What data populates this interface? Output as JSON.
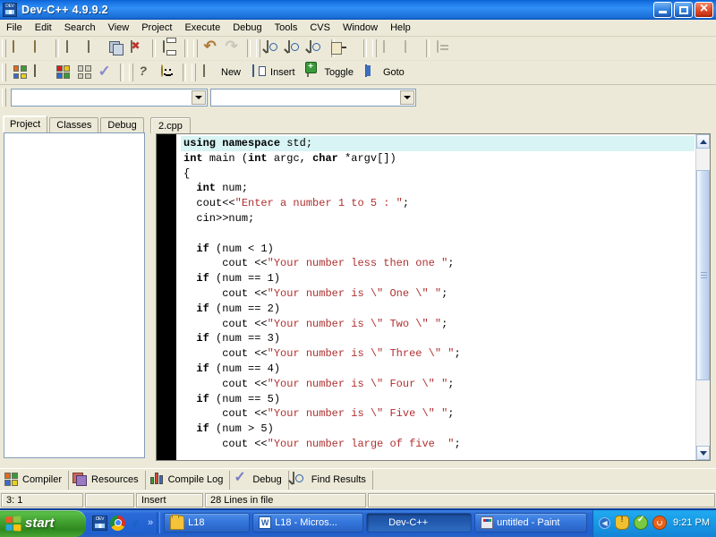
{
  "window": {
    "title": "Dev-C++ 4.9.9.2",
    "app_icon": "devcpp-icon",
    "controls": {
      "minimize": "minimize-button",
      "maximize": "maximize-button",
      "close": "close-button"
    },
    "titlebar_color": "#2f8ef5"
  },
  "menubar": {
    "items": [
      "File",
      "Edit",
      "Search",
      "View",
      "Project",
      "Execute",
      "Debug",
      "Tools",
      "CVS",
      "Window",
      "Help"
    ]
  },
  "toolbar_row1": [
    {
      "name": "new-project-icon",
      "icon": "shield"
    },
    {
      "name": "open-project-icon",
      "icon": "shield2"
    },
    {
      "name": "new-file-icon",
      "icon": "doc"
    },
    {
      "name": "open-file-icon",
      "icon": "doc2"
    },
    {
      "name": "save-file-icon",
      "icon": "saveall"
    },
    {
      "name": "close-file-icon",
      "icon": "closered"
    },
    {
      "name": "print-icon",
      "icon": "print"
    },
    {
      "name": "undo-icon",
      "icon": "undo"
    },
    {
      "name": "redo-icon",
      "icon": "redo"
    },
    {
      "name": "find-icon",
      "icon": "find"
    },
    {
      "name": "find-next-icon",
      "icon": "find"
    },
    {
      "name": "replace-icon",
      "icon": "find"
    },
    {
      "name": "goto-line-icon",
      "icon": "goline"
    },
    {
      "name": "previous-page-icon",
      "icon": "page"
    },
    {
      "name": "next-page-icon",
      "icon": "page"
    },
    {
      "name": "properties-icon",
      "icon": "prop"
    }
  ],
  "toolbar_row2": [
    {
      "name": "project-manager-icon",
      "icon": "grid4c"
    },
    {
      "name": "window-icon",
      "icon": "win"
    },
    {
      "name": "color-grid-icon",
      "icon": "grid4color"
    },
    {
      "name": "tile-icon",
      "icon": "grid4"
    },
    {
      "name": "compile-check-icon",
      "icon": "check"
    },
    {
      "name": "help-icon",
      "icon": "quest"
    },
    {
      "name": "about-icon",
      "icon": "smiley"
    }
  ],
  "toolbar_text_buttons": [
    {
      "name": "new-button",
      "label": "New",
      "icon": "newdoc"
    },
    {
      "name": "insert-button",
      "label": "Insert",
      "icon": "insert"
    },
    {
      "name": "toggle-button",
      "label": "Toggle",
      "icon": "toggle"
    },
    {
      "name": "goto-button",
      "label": "Goto",
      "icon": "goto"
    }
  ],
  "combos": {
    "left_value": "",
    "right_value": ""
  },
  "left_panel": {
    "tabs": [
      {
        "label": "Project",
        "active": true
      },
      {
        "label": "Classes",
        "active": false
      },
      {
        "label": "Debug",
        "active": false
      }
    ],
    "tree_items": []
  },
  "editor": {
    "file_tabs": [
      {
        "label": "2.cpp",
        "active": true
      }
    ],
    "highlighted_line": 1,
    "code_lines": [
      {
        "indent": 0,
        "highlight": true,
        "tokens": [
          {
            "t": "kw",
            "v": "using namespace "
          },
          {
            "t": "pl",
            "v": "std;"
          }
        ]
      },
      {
        "indent": 0,
        "highlight": false,
        "tokens": [
          {
            "t": "kw",
            "v": "int "
          },
          {
            "t": "pl",
            "v": "main ("
          },
          {
            "t": "kw",
            "v": "int "
          },
          {
            "t": "pl",
            "v": "argc, "
          },
          {
            "t": "kw",
            "v": "char "
          },
          {
            "t": "pl",
            "v": "*argv[])"
          }
        ]
      },
      {
        "indent": 0,
        "highlight": false,
        "tokens": [
          {
            "t": "pl",
            "v": "{"
          }
        ]
      },
      {
        "indent": 1,
        "highlight": false,
        "tokens": [
          {
            "t": "kw",
            "v": "int "
          },
          {
            "t": "pl",
            "v": "num;"
          }
        ]
      },
      {
        "indent": 1,
        "highlight": false,
        "tokens": [
          {
            "t": "pl",
            "v": "cout<<"
          },
          {
            "t": "st",
            "v": "\"Enter a number 1 to 5 : \""
          },
          {
            "t": "pl",
            "v": ";"
          }
        ]
      },
      {
        "indent": 1,
        "highlight": false,
        "tokens": [
          {
            "t": "pl",
            "v": "cin>>num;"
          }
        ]
      },
      {
        "indent": 0,
        "highlight": false,
        "tokens": [
          {
            "t": "pl",
            "v": ""
          }
        ]
      },
      {
        "indent": 1,
        "highlight": false,
        "tokens": [
          {
            "t": "kw",
            "v": "if "
          },
          {
            "t": "pl",
            "v": "(num < 1)"
          }
        ]
      },
      {
        "indent": 3,
        "highlight": false,
        "tokens": [
          {
            "t": "pl",
            "v": "cout <<"
          },
          {
            "t": "st",
            "v": "\"Your number less then one \""
          },
          {
            "t": "pl",
            "v": ";"
          }
        ]
      },
      {
        "indent": 1,
        "highlight": false,
        "tokens": [
          {
            "t": "kw",
            "v": "if "
          },
          {
            "t": "pl",
            "v": "(num == 1)"
          }
        ]
      },
      {
        "indent": 3,
        "highlight": false,
        "tokens": [
          {
            "t": "pl",
            "v": "cout <<"
          },
          {
            "t": "st",
            "v": "\"Your number is \\\" One \\\" \""
          },
          {
            "t": "pl",
            "v": ";"
          }
        ]
      },
      {
        "indent": 1,
        "highlight": false,
        "tokens": [
          {
            "t": "kw",
            "v": "if "
          },
          {
            "t": "pl",
            "v": "(num == 2)"
          }
        ]
      },
      {
        "indent": 3,
        "highlight": false,
        "tokens": [
          {
            "t": "pl",
            "v": "cout <<"
          },
          {
            "t": "st",
            "v": "\"Your number is \\\" Two \\\" \""
          },
          {
            "t": "pl",
            "v": ";"
          }
        ]
      },
      {
        "indent": 1,
        "highlight": false,
        "tokens": [
          {
            "t": "kw",
            "v": "if "
          },
          {
            "t": "pl",
            "v": "(num == 3)"
          }
        ]
      },
      {
        "indent": 3,
        "highlight": false,
        "tokens": [
          {
            "t": "pl",
            "v": "cout <<"
          },
          {
            "t": "st",
            "v": "\"Your number is \\\" Three \\\" \""
          },
          {
            "t": "pl",
            "v": ";"
          }
        ]
      },
      {
        "indent": 1,
        "highlight": false,
        "tokens": [
          {
            "t": "kw",
            "v": "if "
          },
          {
            "t": "pl",
            "v": "(num == 4)"
          }
        ]
      },
      {
        "indent": 3,
        "highlight": false,
        "tokens": [
          {
            "t": "pl",
            "v": "cout <<"
          },
          {
            "t": "st",
            "v": "\"Your number is \\\" Four \\\" \""
          },
          {
            "t": "pl",
            "v": ";"
          }
        ]
      },
      {
        "indent": 1,
        "highlight": false,
        "tokens": [
          {
            "t": "kw",
            "v": "if "
          },
          {
            "t": "pl",
            "v": "(num == 5)"
          }
        ]
      },
      {
        "indent": 3,
        "highlight": false,
        "tokens": [
          {
            "t": "pl",
            "v": "cout <<"
          },
          {
            "t": "st",
            "v": "\"Your number is \\\" Five \\\" \""
          },
          {
            "t": "pl",
            "v": ";"
          }
        ]
      },
      {
        "indent": 1,
        "highlight": false,
        "tokens": [
          {
            "t": "kw",
            "v": "if "
          },
          {
            "t": "pl",
            "v": "(num > 5)"
          }
        ]
      },
      {
        "indent": 3,
        "highlight": false,
        "tokens": [
          {
            "t": "pl",
            "v": "cout <<"
          },
          {
            "t": "st",
            "v": "\"Your number large of five  \""
          },
          {
            "t": "pl",
            "v": ";"
          }
        ]
      }
    ]
  },
  "bottom_tabs": [
    {
      "label": "Compiler",
      "icon": "grid4color"
    },
    {
      "label": "Resources",
      "icon": "resources"
    },
    {
      "label": "Compile Log",
      "icon": "chart"
    },
    {
      "label": "Debug",
      "icon": "dbgcheck"
    },
    {
      "label": "Find Results",
      "icon": "find"
    }
  ],
  "statusbar": {
    "cursor": "3: 1",
    "blank": "",
    "mode": "Insert",
    "lines": "28 Lines in file"
  },
  "taskbar": {
    "start_label": "start",
    "quick_launch": [
      {
        "name": "quicklaunch-devcpp-icon"
      },
      {
        "name": "quicklaunch-chrome-icon"
      },
      {
        "name": "quicklaunch-ie-icon"
      }
    ],
    "quick_chevron": "»",
    "buttons": [
      {
        "label": "L18",
        "icon": "folder",
        "active": false
      },
      {
        "label": "L18 - Micros...",
        "icon": "word",
        "active": false
      },
      {
        "label": "Dev-C++",
        "icon": "devcpp",
        "active": true
      },
      {
        "label": "untitled - Paint",
        "icon": "paint",
        "active": false
      }
    ],
    "tray": {
      "chevron": "◀",
      "icons": [
        {
          "name": "security-shield-icon"
        },
        {
          "name": "antivirus-check-icon"
        },
        {
          "name": "update-icon"
        }
      ],
      "clock": "9:21 PM"
    }
  }
}
